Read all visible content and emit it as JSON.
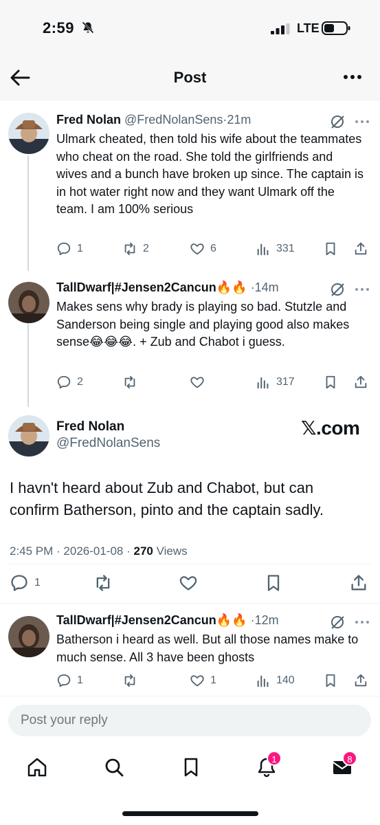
{
  "status": {
    "time": "2:59",
    "network": "LTE"
  },
  "header": {
    "title": "Post"
  },
  "replies": [
    {
      "name": "Fred Nolan",
      "handle": "@FredNolanSens",
      "sep": "·",
      "time": "21m",
      "text": "Ulmark cheated, then told his wife about the teammates who cheat on the road.  She told the girlfriends and wives and a bunch have broken up since.  The captain is in hot water right now and they want Ulmark off the team.  I am 100% serious",
      "replies": "1",
      "reposts": "2",
      "likes": "6",
      "views": "331"
    },
    {
      "name": "TallDwarf|#Jensen2Cancun🔥🔥",
      "handle": "",
      "sep": "·",
      "time": "14m",
      "text": "Makes sens why brady is playing so bad. Stutzle and Sanderson being single and playing good also makes sense😂😂😂. + Zub and Chabot i guess.",
      "replies": "2",
      "reposts": "",
      "likes": "",
      "views": "317"
    },
    {
      "name": "TallDwarf|#Jensen2Cancun🔥🔥",
      "handle": "",
      "sep": "·",
      "time": "12m",
      "text": "Batherson i heard as well. But all those names make to much sense. All 3 have been ghosts",
      "replies": "1",
      "reposts": "",
      "likes": "1",
      "views": "140"
    }
  ],
  "main": {
    "name": "Fred Nolan",
    "handle": "@FredNolanSens",
    "watermark": "𝕏.com",
    "text": "I havn't heard about Zub and Chabot, but can confirm Batherson, pinto and the captain sadly.",
    "timestamp": "2:45 PM · 2026-01-08 · ",
    "views_count": "270",
    "views_label": " Views",
    "replies": "1"
  },
  "reply_box": {
    "placeholder": "Post your reply"
  },
  "tabbar": {
    "notifications_badge": "1",
    "messages_badge": "8"
  }
}
